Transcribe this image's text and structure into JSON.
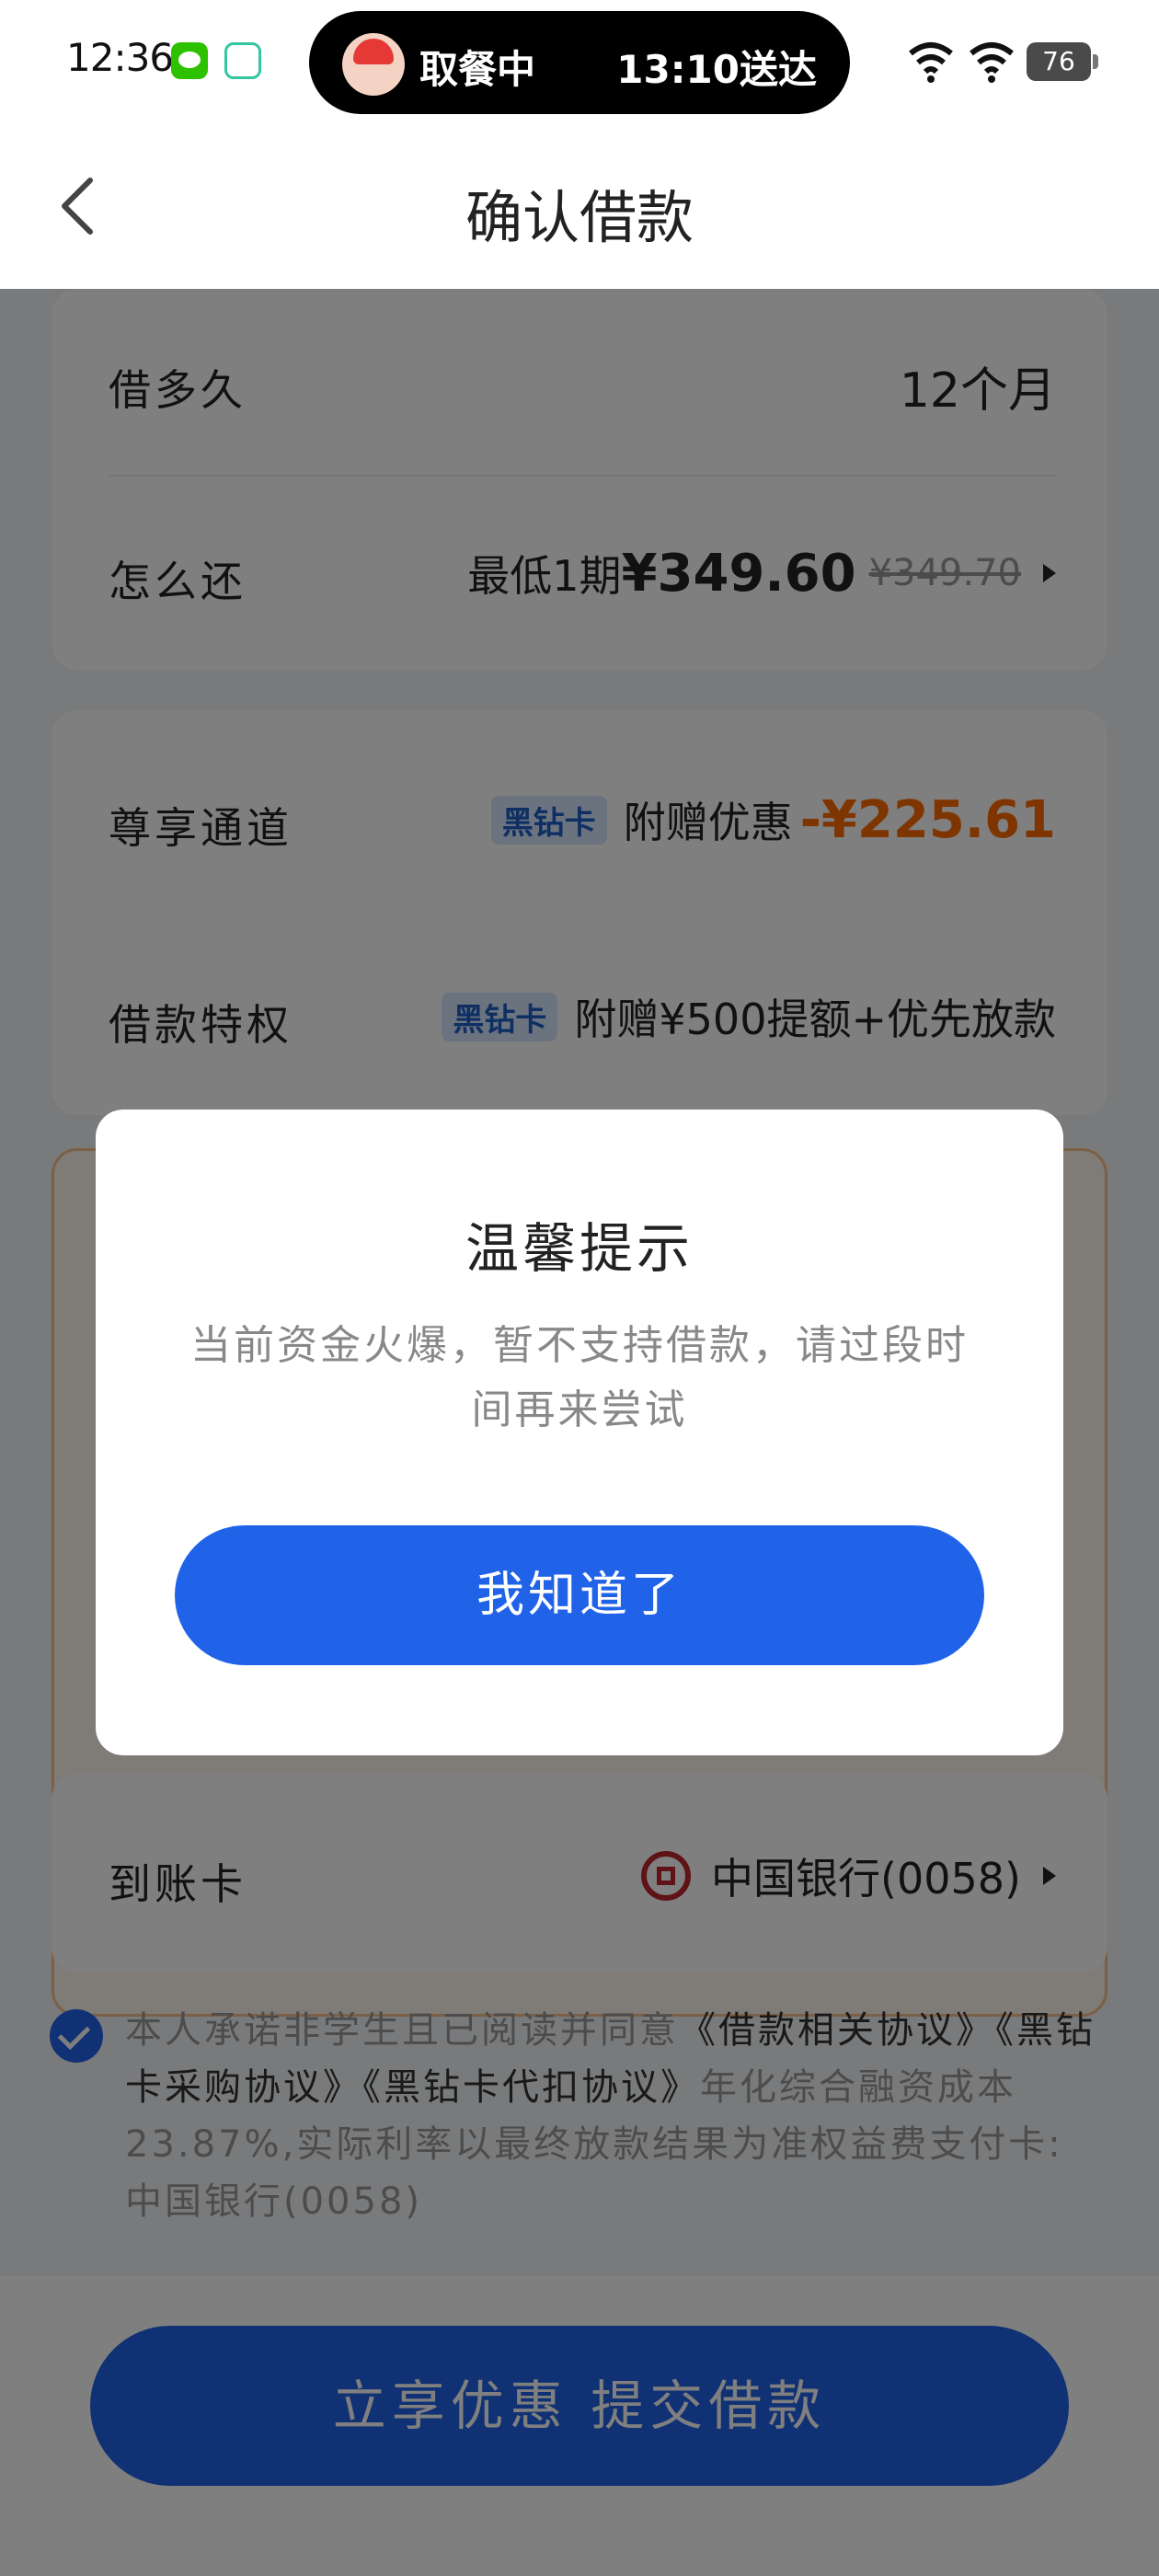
{
  "status_bar": {
    "time": "12:36",
    "island_left": "取餐中",
    "island_right": "13:10送达",
    "battery": "76"
  },
  "nav": {
    "title": "确认借款"
  },
  "loan": {
    "term_label": "借多久",
    "term_value": "12个月",
    "repay_label": "怎么还",
    "repay_prefix": "最低1期",
    "repay_amount": "¥349.60",
    "repay_original": "¥349.70"
  },
  "privilege": {
    "exclusive_label": "尊享通道",
    "badge": "黑钻卡",
    "gift_text": "附赠优惠",
    "discount": "-¥225.61",
    "loan_priv_label": "借款特权",
    "loan_priv_badge": "黑钻卡",
    "loan_priv_value": "附赠¥500提额+优先放款"
  },
  "receive_card": {
    "label": "到账卡",
    "bank": "中国银行(0058)"
  },
  "agreement": {
    "pre": "本人承诺非学生且已阅读并同意",
    "link1": "《借款相关协议》",
    "link2": "《黑钻卡采购协议》",
    "link3": "《黑钻卡代扣协议》",
    "post": "年化综合融资成本23.87%,实际利率以最终放款结果为准权益费支付卡:中国银行(0058)"
  },
  "submit": {
    "label": "立享优惠 提交借款"
  },
  "dialog": {
    "title": "温馨提示",
    "message": "当前资金火爆，暂不支持借款，请过段时间再来尝试",
    "button": "我知道了"
  },
  "colors": {
    "primary": "#2163e8",
    "discount": "#ff6a00",
    "bank_red": "#c0262d"
  }
}
